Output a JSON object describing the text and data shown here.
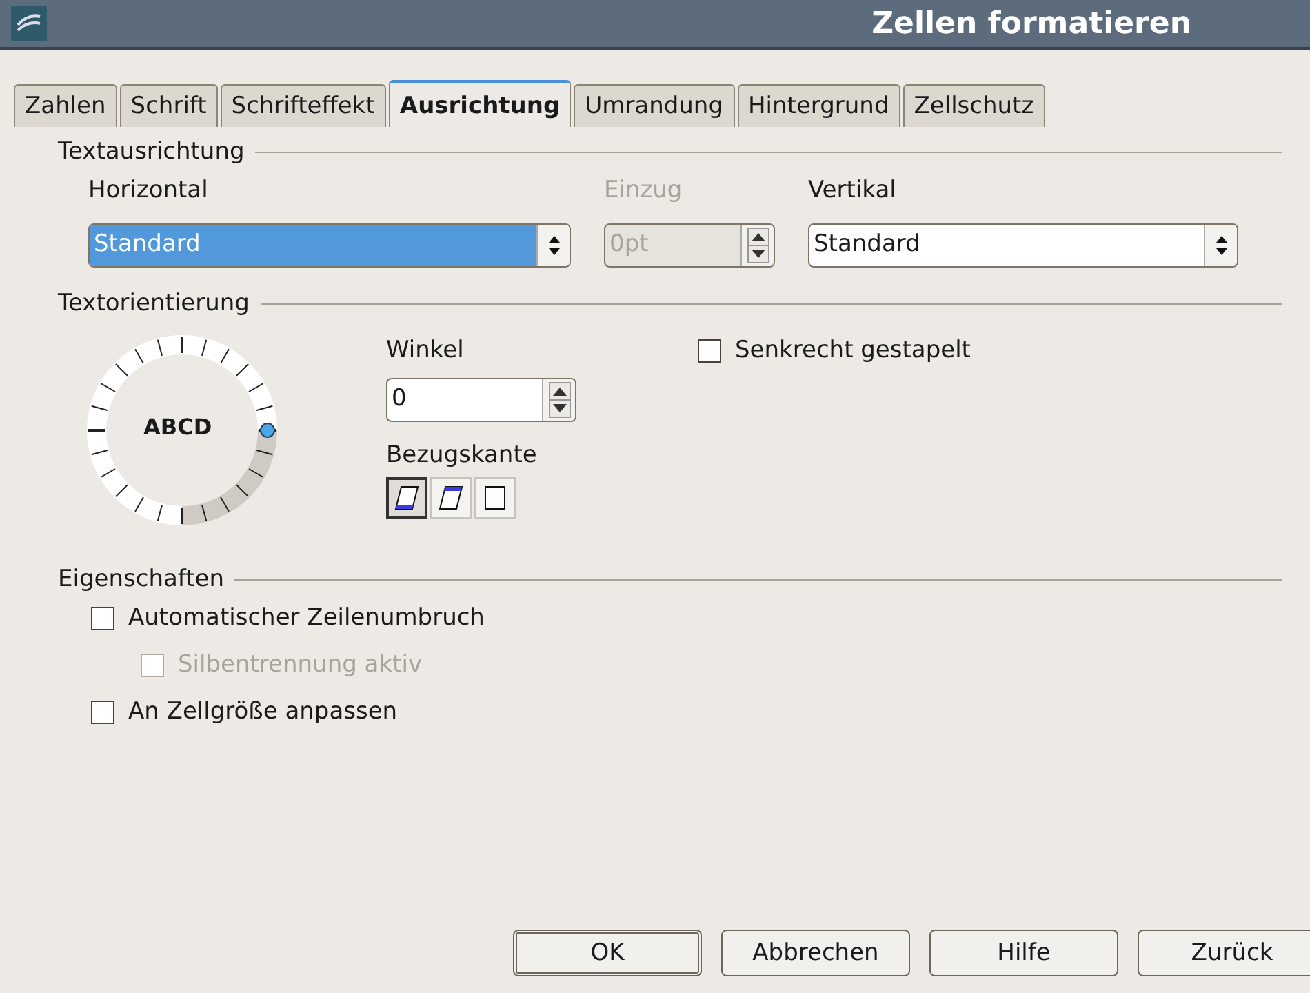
{
  "window": {
    "title": "Zellen formatieren"
  },
  "tabs": [
    {
      "label": "Zahlen",
      "selected": false
    },
    {
      "label": "Schrift",
      "selected": false
    },
    {
      "label": "Schrifteffekt",
      "selected": false
    },
    {
      "label": "Ausrichtung",
      "selected": true
    },
    {
      "label": "Umrandung",
      "selected": false
    },
    {
      "label": "Hintergrund",
      "selected": false
    },
    {
      "label": "Zellschutz",
      "selected": false
    }
  ],
  "text_alignment": {
    "title": "Textausrichtung",
    "fields": [
      {
        "label": "Horizontal",
        "value": "Standard",
        "kind": "dropdown",
        "disabled": false,
        "highlighted": true
      },
      {
        "label": "Einzug",
        "value": "0pt",
        "kind": "spin",
        "disabled": true,
        "highlighted": false
      },
      {
        "label": "Vertikal",
        "value": "Standard",
        "kind": "dropdown",
        "disabled": false,
        "highlighted": false
      }
    ]
  },
  "text_orientation": {
    "title": "Textorientierung",
    "dial_text": "ABCD",
    "angle_label": "Winkel",
    "angle_value": "0",
    "reference_edge_label": "Bezugskante",
    "reference_edges": [
      {
        "selected": true
      },
      {
        "selected": false
      },
      {
        "selected": false
      }
    ],
    "stacked": {
      "label": "Senkrecht gestapelt",
      "checked": false,
      "disabled": false
    }
  },
  "properties": {
    "title": "Eigenschaften",
    "options": [
      {
        "label": "Automatischer Zeilenumbruch",
        "checked": false,
        "disabled": false,
        "children": [
          {
            "label": "Silbentrennung aktiv",
            "checked": false,
            "disabled": true
          }
        ]
      },
      {
        "label": "An Zellgröße anpassen",
        "checked": false,
        "disabled": false
      }
    ]
  },
  "buttons": [
    {
      "label": "OK",
      "default": true
    },
    {
      "label": "Abbrechen",
      "default": false
    },
    {
      "label": "Hilfe",
      "default": false
    },
    {
      "label": "Zurück",
      "default": false
    }
  ]
}
